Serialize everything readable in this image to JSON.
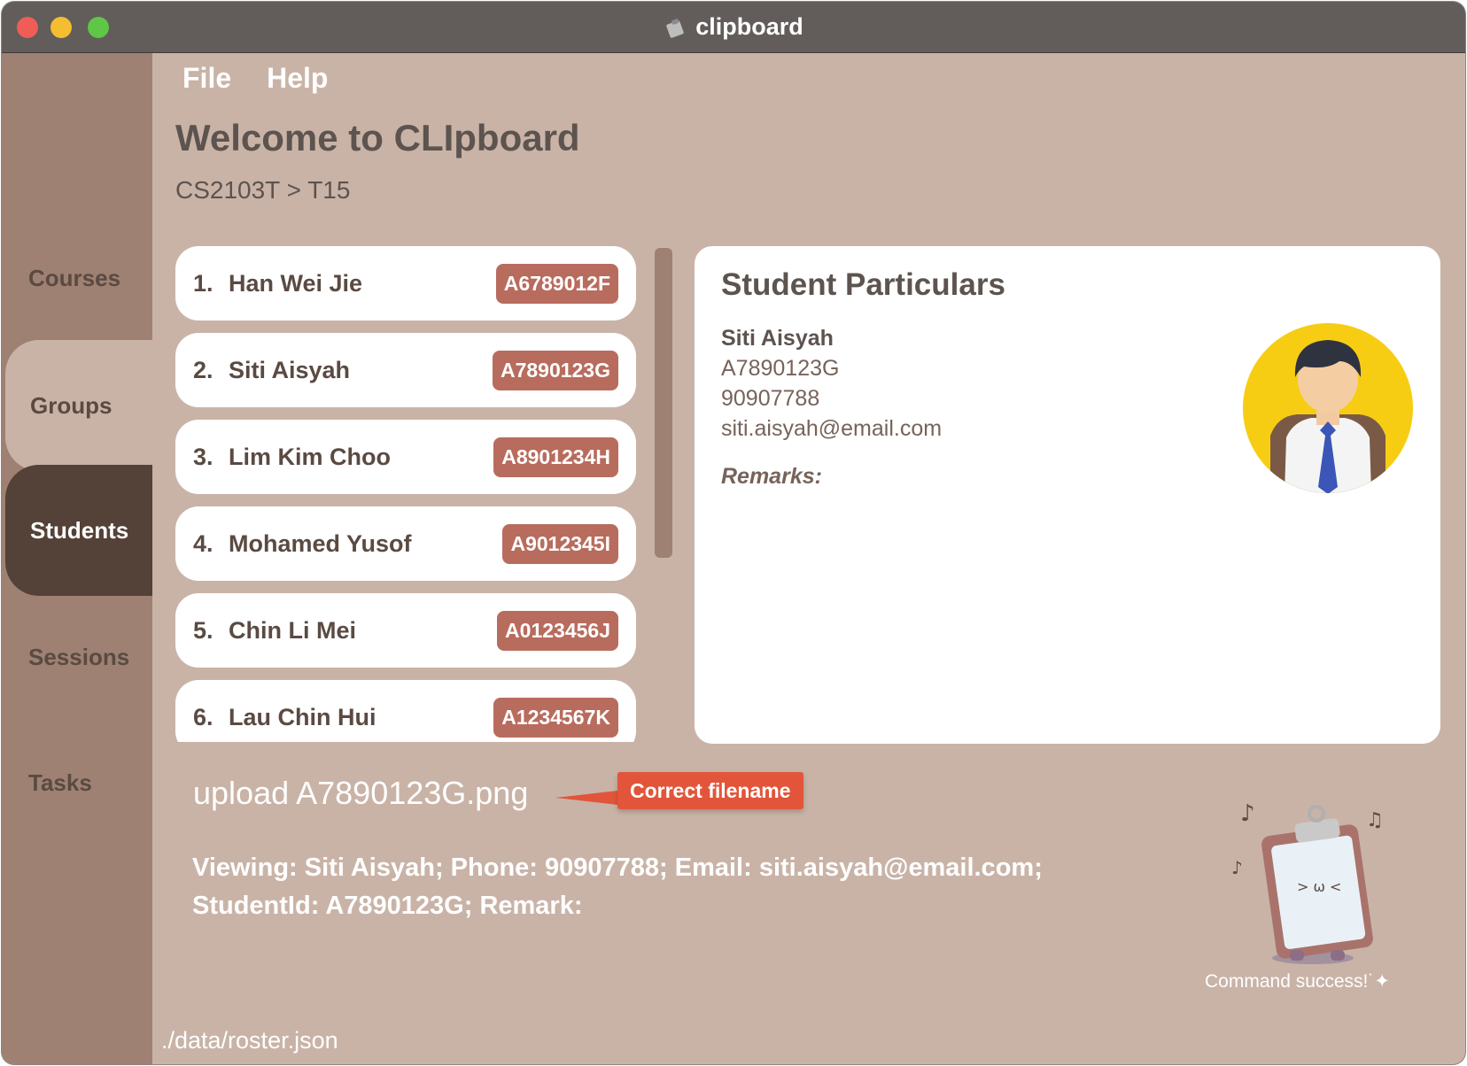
{
  "window": {
    "title": "clipboard"
  },
  "menu": {
    "file": "File",
    "help": "Help"
  },
  "sidebar": {
    "items": [
      {
        "label": "Courses"
      },
      {
        "label": "Groups"
      },
      {
        "label": "Students"
      },
      {
        "label": "Sessions"
      },
      {
        "label": "Tasks"
      }
    ]
  },
  "header": {
    "title": "Welcome to CLIpboard",
    "breadcrumb": "CS2103T > T15"
  },
  "students": [
    {
      "index": "1.",
      "name": "Han Wei Jie",
      "id": "A6789012F"
    },
    {
      "index": "2.",
      "name": "Siti Aisyah",
      "id": "A7890123G"
    },
    {
      "index": "3.",
      "name": "Lim Kim Choo",
      "id": "A8901234H"
    },
    {
      "index": "4.",
      "name": "Mohamed Yusof",
      "id": "A9012345I"
    },
    {
      "index": "5.",
      "name": "Chin Li Mei",
      "id": "A0123456J"
    },
    {
      "index": "6.",
      "name": "Lau Chin Hui",
      "id": "A1234567K"
    }
  ],
  "particulars": {
    "title": "Student Particulars",
    "name": "Siti Aisyah",
    "id": "A7890123G",
    "phone": "90907788",
    "email": "siti.aisyah@email.com",
    "remarks_label": "Remarks:"
  },
  "command": {
    "input": "upload A7890123G.png",
    "callout": "Correct filename",
    "result_line1": "Viewing: Siti Aisyah; Phone: 90907788; Email: siti.aisyah@email.com;",
    "result_line2": "StudentId: A7890123G; Remark:"
  },
  "mascot": {
    "caption": "Command success!˙✦"
  },
  "footer": {
    "path": "./data/roster.json"
  },
  "colors": {
    "background": "#c9b3a7",
    "sidebar": "#9e8172",
    "active_nav": "#544137",
    "id_badge": "#b86c5e",
    "callout": "#e2553a"
  }
}
